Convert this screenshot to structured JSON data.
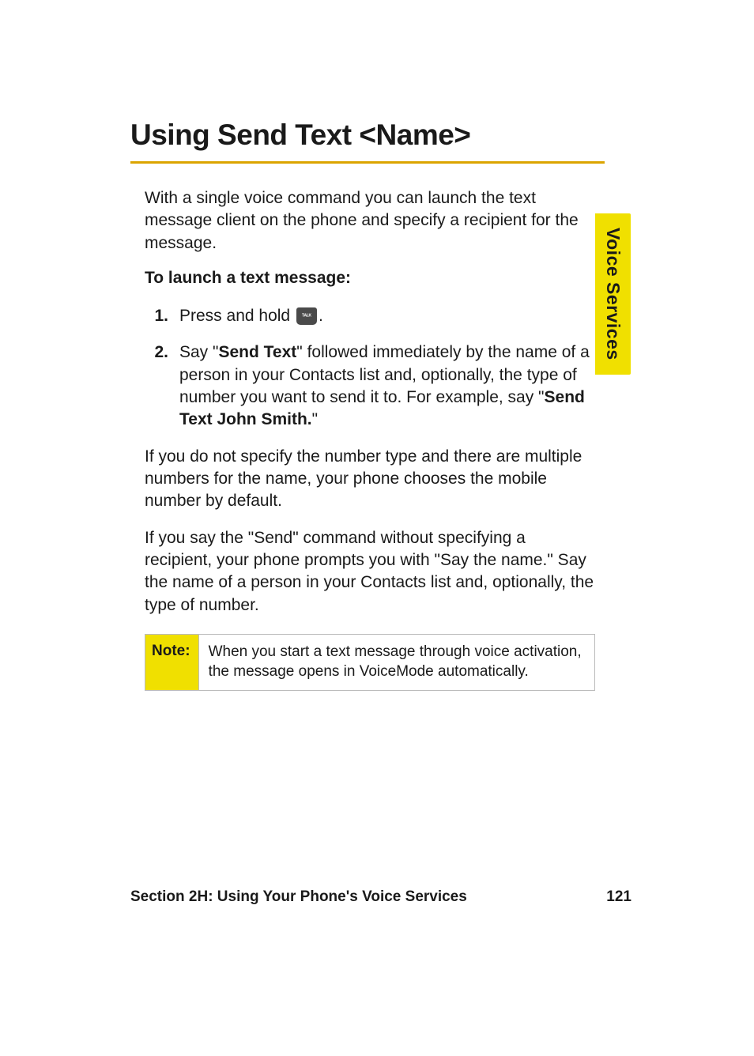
{
  "side_tab": "Voice Services",
  "heading": "Using Send Text <Name>",
  "intro": "With a single voice command you can launch the text message client on the phone and specify a recipient for the message.",
  "subheading": "To launch a text message:",
  "steps": [
    {
      "num": "1.",
      "pre": "Press and hold ",
      "has_icon": true,
      "post": "."
    },
    {
      "num": "2.",
      "parts": {
        "t1": "Say \"",
        "b1": "Send Text",
        "t2": "\" followed immediately by the name of a person in your Contacts list and, optionally, the type of number you want to send it to. For example, say \"",
        "b2": "Send Text John Smith.",
        "t3": "\""
      }
    }
  ],
  "para_after1": "If you do not specify the number type and there are multiple numbers for the name, your phone chooses the mobile number by default.",
  "para_after2": "If you say the \"Send\" command without specifying a recipient, your phone prompts you with \"Say the name.\" Say the name of a person in your Contacts list and, optionally, the type of number.",
  "note": {
    "label": "Note:",
    "text": "When you start a text message through voice activation, the message opens in VoiceMode automatically."
  },
  "footer": {
    "section": "Section 2H: Using Your Phone's Voice Services",
    "page": "121"
  }
}
